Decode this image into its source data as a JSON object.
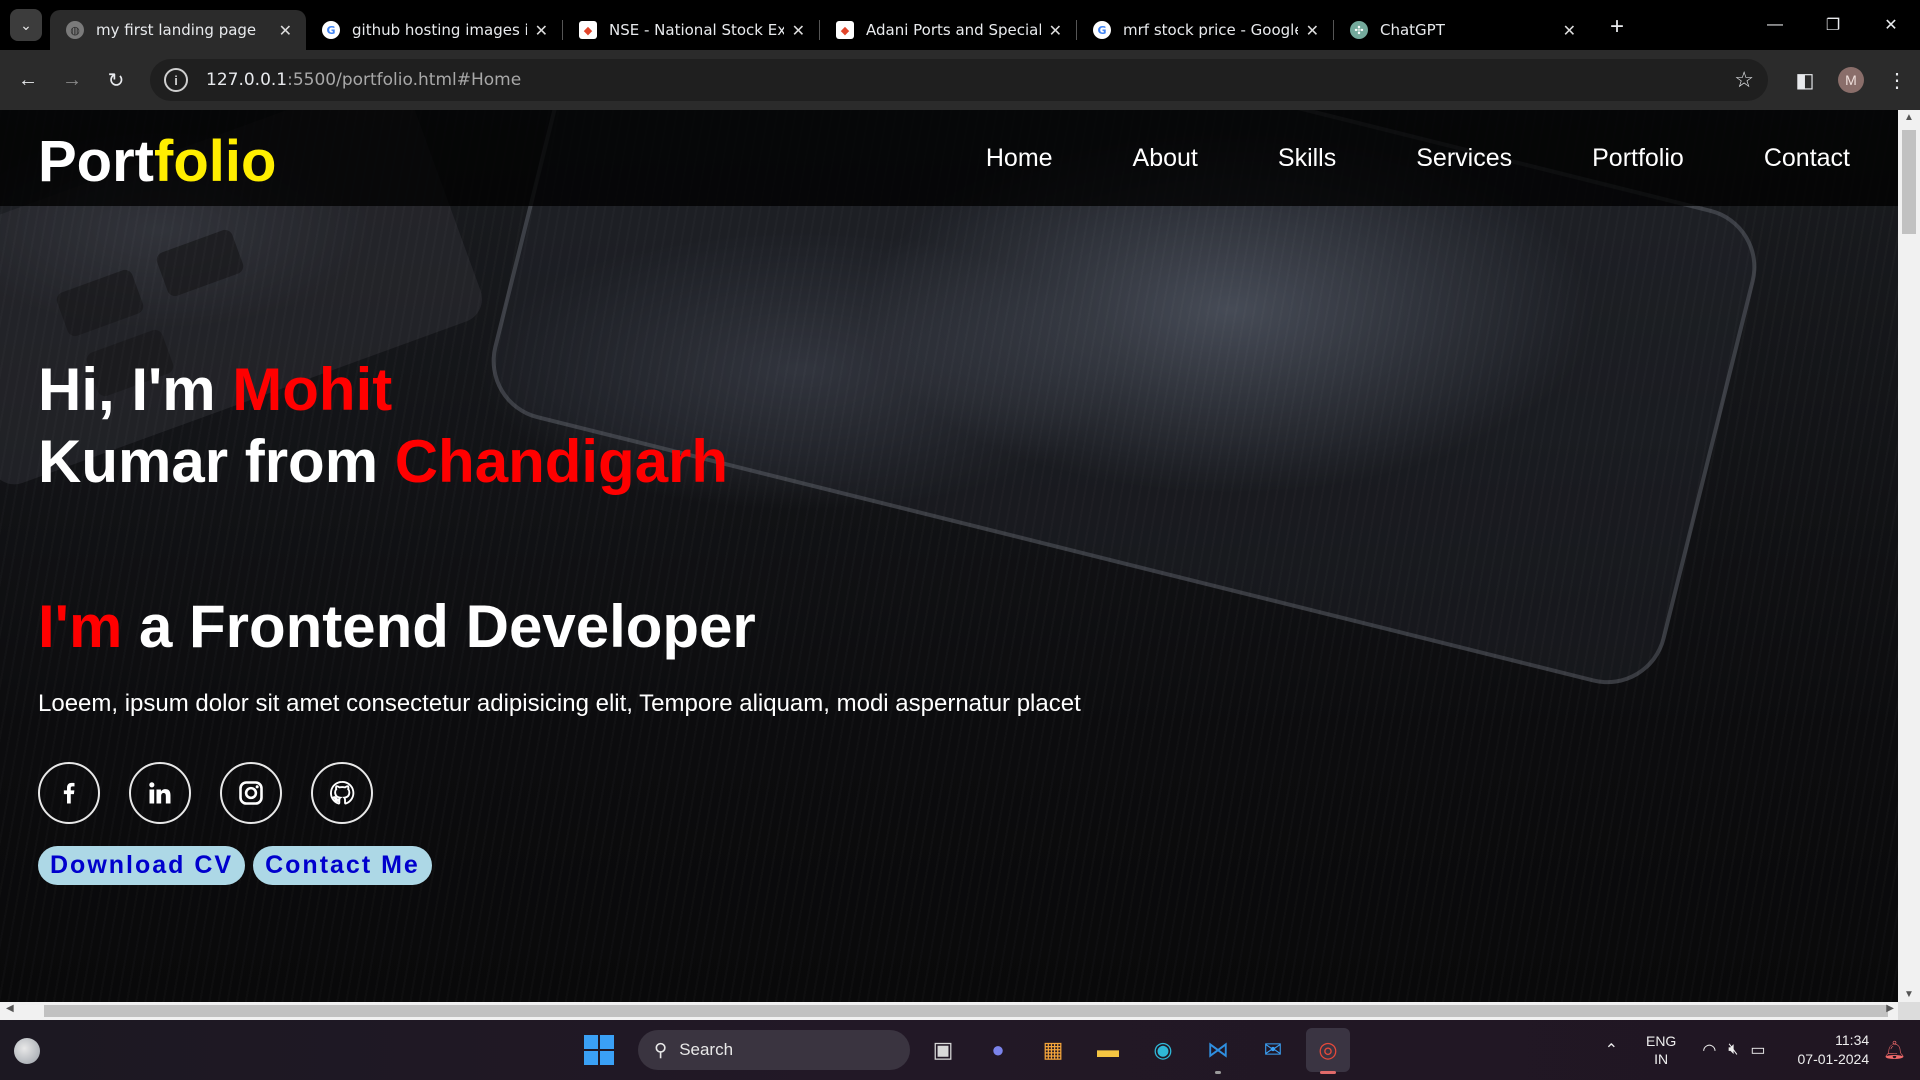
{
  "browser": {
    "tabs": [
      {
        "title": "my first landing page",
        "active": true
      },
      {
        "title": "github hosting images in jp",
        "active": false
      },
      {
        "title": "NSE - National Stock Excha",
        "active": false
      },
      {
        "title": "Adani Ports and Special Ec",
        "active": false
      },
      {
        "title": "mrf stock price - Google Sc",
        "active": false
      },
      {
        "title": "ChatGPT",
        "active": false
      }
    ],
    "url_host": "127.0.0.1",
    "url_rest": ":5500/portfolio.html#Home",
    "avatar_initial": "M"
  },
  "page": {
    "logo_main": "Port",
    "logo_accent": "folio",
    "nav": [
      "Home",
      "About",
      "Skills",
      "Services",
      "Portfolio",
      "Contact"
    ],
    "intro_line1_prefix": "Hi, I'm ",
    "intro_name": "Mohit",
    "intro_line2_prefix": "Kumar from ",
    "intro_city": "Chandigarh",
    "role_accent": "I'm",
    "role_rest": " a Frontend Developer",
    "description": "Loeem, ipsum dolor sit amet consectetur adipisicing elit, Tempore aliquam, modi aspernatur placet",
    "social_icons": [
      "facebook-icon",
      "linkedin-icon",
      "instagram-icon",
      "github-icon"
    ],
    "buttons": {
      "download": "Download CV",
      "contact": "Contact Me"
    },
    "colors": {
      "logo_accent": "#ffee00",
      "highlight": "#ff0000",
      "button_bg": "#add8e6",
      "button_text": "#0000cd"
    }
  },
  "taskbar": {
    "search_label": "Search",
    "lang_line1": "ENG",
    "lang_line2": "IN",
    "time": "11:34",
    "date": "07-01-2024"
  }
}
